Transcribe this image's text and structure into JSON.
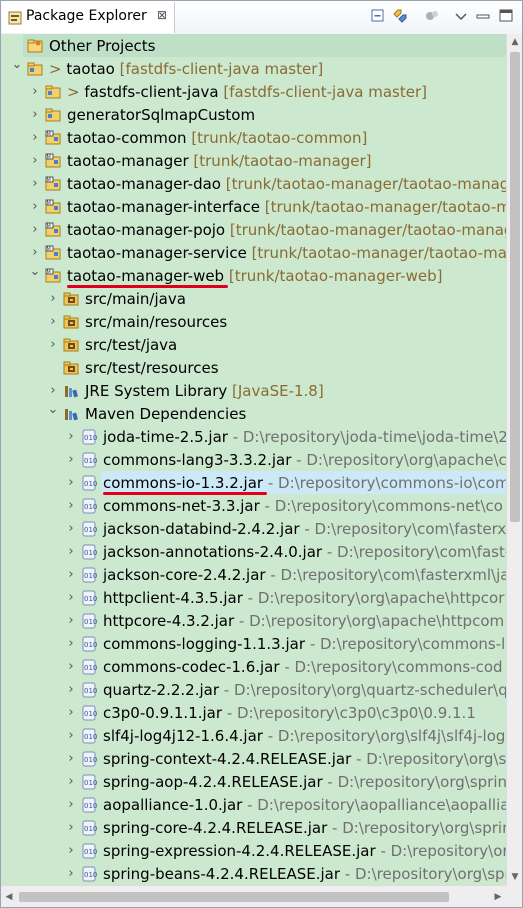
{
  "view": {
    "title": "Package Explorer",
    "close_glyph": "⊠",
    "toolbar_icons": [
      "collapse-all-icon",
      "link-with-editor-icon",
      "filters-icon",
      "view-menu-icon",
      "minimize-icon",
      "maximize-icon"
    ]
  },
  "tree": {
    "rows": [
      {
        "depth": 0,
        "expander": "none",
        "icon": "working-set-icon",
        "label": "Other Projects",
        "decoration": "",
        "path": "",
        "highlight": "sel-first"
      },
      {
        "depth": 0,
        "expander": "open",
        "icon": "project-icon",
        "label": "> taotao",
        "decoration": "[fastdfs-client-java master]",
        "path": ""
      },
      {
        "depth": 1,
        "expander": "closed",
        "icon": "project-icon",
        "label": "> fastdfs-client-java",
        "decoration": "[fastdfs-client-java master]",
        "path": ""
      },
      {
        "depth": 1,
        "expander": "closed",
        "icon": "project-icon",
        "label": "generatorSqlmapCustom",
        "decoration": "",
        "path": ""
      },
      {
        "depth": 1,
        "expander": "closed",
        "icon": "maven-project-icon",
        "label": "taotao-common",
        "decoration": "[trunk/taotao-common]",
        "path": ""
      },
      {
        "depth": 1,
        "expander": "closed",
        "icon": "maven-project-icon",
        "label": "taotao-manager",
        "decoration": "[trunk/taotao-manager]",
        "path": ""
      },
      {
        "depth": 1,
        "expander": "closed",
        "icon": "maven-project-icon",
        "label": "taotao-manager-dao",
        "decoration": "[trunk/taotao-manager/taotao-manager-dao]",
        "path": ""
      },
      {
        "depth": 1,
        "expander": "closed",
        "icon": "maven-project-icon",
        "label": "taotao-manager-interface",
        "decoration": "[trunk/taotao-manager/taotao-manager-interface]",
        "path": ""
      },
      {
        "depth": 1,
        "expander": "closed",
        "icon": "maven-project-icon",
        "label": "taotao-manager-pojo",
        "decoration": "[trunk/taotao-manager/taotao-manager-pojo]",
        "path": ""
      },
      {
        "depth": 1,
        "expander": "closed",
        "icon": "maven-project-icon",
        "label": "taotao-manager-service",
        "decoration": "[trunk/taotao-manager/taotao-manager-service]",
        "path": ""
      },
      {
        "depth": 1,
        "expander": "open",
        "icon": "maven-project-icon",
        "label": "taotao-manager-web",
        "decoration": "[trunk/taotao-manager-web]",
        "path": "",
        "underline": true
      },
      {
        "depth": 2,
        "expander": "closed",
        "icon": "source-folder-icon",
        "label": "src/main/java",
        "decoration": "",
        "path": ""
      },
      {
        "depth": 2,
        "expander": "closed",
        "icon": "source-folder-icon",
        "label": "src/main/resources",
        "decoration": "",
        "path": ""
      },
      {
        "depth": 2,
        "expander": "closed",
        "icon": "source-folder-icon",
        "label": "src/test/java",
        "decoration": "",
        "path": ""
      },
      {
        "depth": 2,
        "expander": "none",
        "icon": "source-folder-icon",
        "label": "src/test/resources",
        "decoration": "",
        "path": ""
      },
      {
        "depth": 2,
        "expander": "closed",
        "icon": "library-icon",
        "label": "JRE System Library",
        "decoration": "[JavaSE-1.8]",
        "path": ""
      },
      {
        "depth": 2,
        "expander": "open",
        "icon": "library-icon",
        "label": "Maven Dependencies",
        "decoration": "",
        "path": ""
      },
      {
        "depth": 3,
        "expander": "closed",
        "icon": "jar-icon",
        "label": "joda-time-2.5.jar",
        "decoration": "",
        "path": "- D:\\repository\\joda-time\\joda-time\\2"
      },
      {
        "depth": 3,
        "expander": "closed",
        "icon": "jar-icon",
        "label": "commons-lang3-3.3.2.jar",
        "decoration": "",
        "path": "- D:\\repository\\org\\apache\\co"
      },
      {
        "depth": 3,
        "expander": "closed",
        "icon": "jar-icon",
        "label": "commons-io-1.3.2.jar",
        "decoration": "",
        "path": "- D:\\repository\\commons-io\\com",
        "selected": true,
        "underline": true
      },
      {
        "depth": 3,
        "expander": "closed",
        "icon": "jar-icon",
        "label": "commons-net-3.3.jar",
        "decoration": "",
        "path": "- D:\\repository\\commons-net\\co"
      },
      {
        "depth": 3,
        "expander": "closed",
        "icon": "jar-icon",
        "label": "jackson-databind-2.4.2.jar",
        "decoration": "",
        "path": "- D:\\repository\\com\\fasterxm"
      },
      {
        "depth": 3,
        "expander": "closed",
        "icon": "jar-icon",
        "label": "jackson-annotations-2.4.0.jar",
        "decoration": "",
        "path": "- D:\\repository\\com\\faste"
      },
      {
        "depth": 3,
        "expander": "closed",
        "icon": "jar-icon",
        "label": "jackson-core-2.4.2.jar",
        "decoration": "",
        "path": "- D:\\repository\\com\\fasterxml\\ja"
      },
      {
        "depth": 3,
        "expander": "closed",
        "icon": "jar-icon",
        "label": "httpclient-4.3.5.jar",
        "decoration": "",
        "path": "- D:\\repository\\org\\apache\\httpcor"
      },
      {
        "depth": 3,
        "expander": "closed",
        "icon": "jar-icon",
        "label": "httpcore-4.3.2.jar",
        "decoration": "",
        "path": "- D:\\repository\\org\\apache\\httpcom"
      },
      {
        "depth": 3,
        "expander": "closed",
        "icon": "jar-icon",
        "label": "commons-logging-1.1.3.jar",
        "decoration": "",
        "path": "- D:\\repository\\commons-l"
      },
      {
        "depth": 3,
        "expander": "closed",
        "icon": "jar-icon",
        "label": "commons-codec-1.6.jar",
        "decoration": "",
        "path": "- D:\\repository\\commons-cod"
      },
      {
        "depth": 3,
        "expander": "closed",
        "icon": "jar-icon",
        "label": "quartz-2.2.2.jar",
        "decoration": "",
        "path": "- D:\\repository\\org\\quartz-scheduler\\q"
      },
      {
        "depth": 3,
        "expander": "closed",
        "icon": "jar-icon",
        "label": "c3p0-0.9.1.1.jar",
        "decoration": "",
        "path": "- D:\\repository\\c3p0\\c3p0\\0.9.1.1"
      },
      {
        "depth": 3,
        "expander": "closed",
        "icon": "jar-icon",
        "label": "slf4j-log4j12-1.6.4.jar",
        "decoration": "",
        "path": "- D:\\repository\\org\\slf4j\\slf4j-log"
      },
      {
        "depth": 3,
        "expander": "closed",
        "icon": "jar-icon",
        "label": "spring-context-4.2.4.RELEASE.jar",
        "decoration": "",
        "path": "- D:\\repository\\org\\spr"
      },
      {
        "depth": 3,
        "expander": "closed",
        "icon": "jar-icon",
        "label": "spring-aop-4.2.4.RELEASE.jar",
        "decoration": "",
        "path": "- D:\\repository\\org\\spring"
      },
      {
        "depth": 3,
        "expander": "closed",
        "icon": "jar-icon",
        "label": "aopalliance-1.0.jar",
        "decoration": "",
        "path": "- D:\\repository\\aopalliance\\aopallian"
      },
      {
        "depth": 3,
        "expander": "closed",
        "icon": "jar-icon",
        "label": "spring-core-4.2.4.RELEASE.jar",
        "decoration": "",
        "path": "- D:\\repository\\org\\sprin"
      },
      {
        "depth": 3,
        "expander": "closed",
        "icon": "jar-icon",
        "label": "spring-expression-4.2.4.RELEASE.jar",
        "decoration": "",
        "path": "- D:\\repository\\org"
      },
      {
        "depth": 3,
        "expander": "closed",
        "icon": "jar-icon",
        "label": "spring-beans-4.2.4.RELEASE.jar",
        "decoration": "",
        "path": "- D:\\repository\\org\\spr"
      }
    ]
  },
  "colors": {
    "tree_background": "#cce8cf",
    "selection": "#cde8f7",
    "decoration": "#8a6b33",
    "path": "#707070",
    "annotation_underline": "#e0001b"
  }
}
